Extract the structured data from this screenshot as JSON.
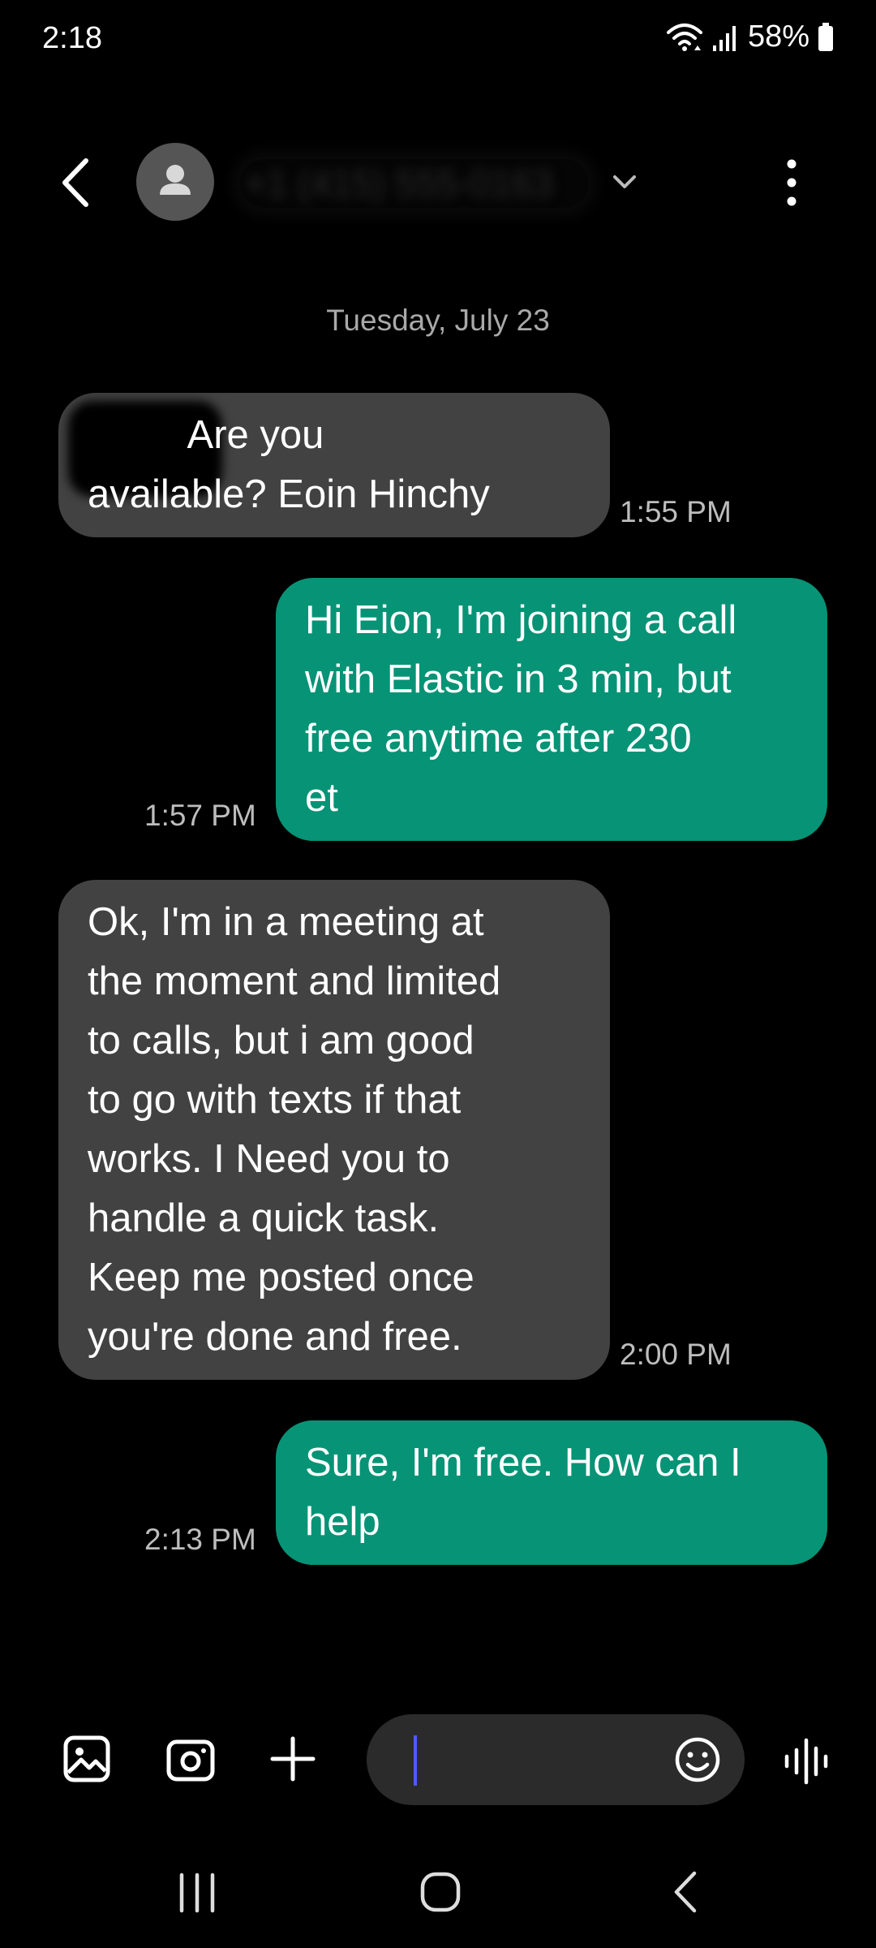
{
  "status_bar": {
    "time": "2:18",
    "battery": "58%",
    "icons": [
      "wifi-icon",
      "signal-icon",
      "battery-icon"
    ]
  },
  "header": {
    "contact_name": "+1 (415) 555-0163",
    "icons": [
      "back-arrow-icon",
      "avatar-person-icon",
      "chevron-down-icon",
      "more-vertical-icon"
    ]
  },
  "conversation": {
    "date_label": "Tuesday, July 23",
    "messages": [
      {
        "direction": "incoming",
        "text": "         Are you\navailable? Eoin Hinchy",
        "time": "1:55 PM"
      },
      {
        "direction": "outgoing",
        "text": "Hi Eion, I'm joining a call\nwith Elastic in 3 min, but\nfree anytime after 230\net",
        "time": "1:57 PM"
      },
      {
        "direction": "incoming",
        "text": "Ok, I'm in a meeting at\nthe moment and limited\nto calls, but i am good\nto go with texts if that\nworks. I Need you to\nhandle a quick task.\nKeep me posted once\nyou're done and free.",
        "time": "2:00 PM"
      },
      {
        "direction": "outgoing",
        "text": "Sure, I'm free. How can I\nhelp",
        "time": "2:13 PM"
      }
    ]
  },
  "composer": {
    "value": "",
    "placeholder": "",
    "icons": [
      "gallery-icon",
      "camera-icon",
      "plus-icon",
      "emoji-icon",
      "voice-waveform-icon"
    ]
  },
  "nav_bar": {
    "icons": [
      "recent-apps-icon",
      "home-icon",
      "back-icon"
    ]
  },
  "colors": {
    "background": "#000000",
    "incoming_bubble": "#424242",
    "outgoing_bubble": "#079376",
    "caret": "#4f5bff"
  }
}
